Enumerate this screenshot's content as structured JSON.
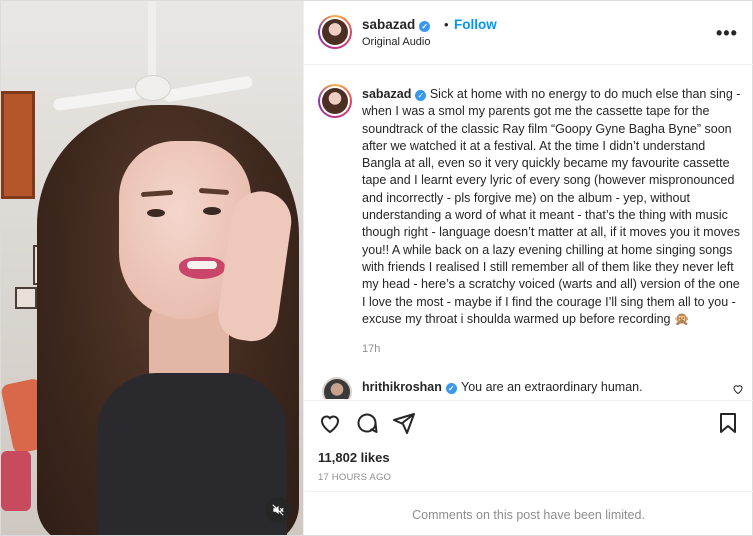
{
  "header": {
    "username": "sabazad",
    "dot": "•",
    "follow_label": "Follow",
    "subtitle": "Original Audio",
    "more_icon": "more-horizontal-icon"
  },
  "caption": {
    "username": "sabazad",
    "text": "Sick at home with no energy to do much else than sing - when I was a smol my parents got me the cassette tape for the soundtrack of the classic Ray film “Goopy Gyne Bagha Byne” soon after we watched it at a festival. At the time I didn’t understand Bangla at all, even so it very quickly became my favourite cassette tape and I learnt every lyric of every song (however mispronounced and incorrectly - pls forgive me) on the album - yep, without understanding a word of what it meant - that’s the thing with music though right - language doesn’t matter at all, if it moves you it moves you!! A while back on a lazy evening chilling at home singing songs with friends I realised I still remember all of them like they never left my head - here’s a scratchy voiced (warts and all) version of the one I love the most - maybe if I find the courage I’ll sing them all to you - excuse my throat i shoulda warmed up before recording 🙊",
    "time": "17h"
  },
  "comment": {
    "username": "hrithikroshan",
    "text": "You are an extraordinary human."
  },
  "actions": {
    "icons": [
      "heart-icon",
      "comment-icon",
      "share-icon",
      "bookmark-icon"
    ]
  },
  "likes": "11,802 likes",
  "time_ago": "17 HOURS AGO",
  "limited_notice": "Comments on this post have been limited.",
  "colors": {
    "accent": "#0095f6",
    "verified": "#3897f0",
    "muted_text": "#8e8e8e",
    "border": "#efefef"
  }
}
